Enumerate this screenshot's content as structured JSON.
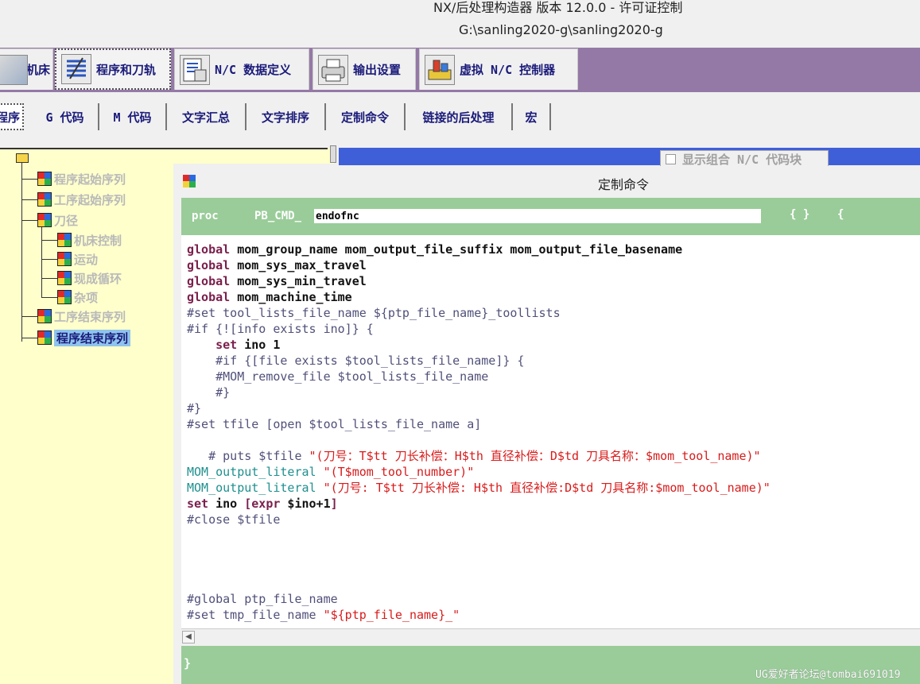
{
  "window": {
    "title": "NX/后处理构造器 版本 12.0.0 - 许可证控制",
    "path": "G:\\sanling2020-g\\sanling2020-g"
  },
  "main_tabs": [
    {
      "label": "机床",
      "icon": "machine-tool-icon"
    },
    {
      "label": "程序和刀轨",
      "icon": "program-toolpath-icon",
      "active": true
    },
    {
      "label": "N/C 数据定义",
      "icon": "nc-data-icon"
    },
    {
      "label": "输出设置",
      "icon": "printer-icon"
    },
    {
      "label": "虚拟 N/C 控制器",
      "icon": "virtual-controller-icon"
    }
  ],
  "sub_tabs": [
    {
      "label": "程序",
      "active": true
    },
    {
      "label": "G 代码"
    },
    {
      "label": "M 代码"
    },
    {
      "label": "文字汇总"
    },
    {
      "label": "文字排序"
    },
    {
      "label": "定制命令"
    },
    {
      "label": "链接的后处理"
    },
    {
      "label": "宏"
    }
  ],
  "tree": {
    "items": [
      {
        "label": "程序起始序列"
      },
      {
        "label": "工序起始序列"
      },
      {
        "label": "刀径"
      },
      {
        "label": "机床控制"
      },
      {
        "label": "运动"
      },
      {
        "label": "现成循环"
      },
      {
        "label": "杂项"
      },
      {
        "label": "工序结束序列"
      },
      {
        "label": "程序结束序列",
        "selected": true
      }
    ]
  },
  "checkbox": {
    "label": "显示组合 N/C 代码块",
    "checked": false
  },
  "dialog": {
    "title": "定制命令",
    "proc_label": "proc",
    "prefix_label": "PB_CMD_",
    "command_name": "endofnc",
    "braces_label": "{ }",
    "open_brace": "{",
    "close_brace": "}"
  },
  "code_lines": [
    [
      {
        "c": "kw",
        "t": "global"
      },
      {
        "c": "tx",
        "t": " mom_group_name mom_output_file_suffix mom_output_file_basename"
      }
    ],
    [
      {
        "c": "kw",
        "t": "global"
      },
      {
        "c": "tx",
        "t": " mom_sys_max_travel"
      }
    ],
    [
      {
        "c": "kw",
        "t": "global"
      },
      {
        "c": "tx",
        "t": " mom_sys_min_travel"
      }
    ],
    [
      {
        "c": "kw",
        "t": "global"
      },
      {
        "c": "tx",
        "t": " mom_machine_time"
      }
    ],
    [
      {
        "c": "cm",
        "t": "#set tool_lists_file_name ${ptp_file_name}_toollists"
      }
    ],
    [
      {
        "c": "cm",
        "t": "#if {![info exists ino]} {"
      }
    ],
    [
      {
        "c": "tx",
        "t": "    "
      },
      {
        "c": "kw",
        "t": "set"
      },
      {
        "c": "tx",
        "t": " ino 1"
      }
    ],
    [
      {
        "c": "cm",
        "t": "    #if {[file exists $tool_lists_file_name]} {"
      }
    ],
    [
      {
        "c": "cm",
        "t": "    #MOM_remove_file $tool_lists_file_name"
      }
    ],
    [
      {
        "c": "cm",
        "t": "    #}"
      }
    ],
    [
      {
        "c": "cm",
        "t": "#}"
      }
    ],
    [
      {
        "c": "cm",
        "t": "#set tfile [open $tool_lists_file_name a]"
      }
    ],
    [
      {
        "c": "tx",
        "t": ""
      }
    ],
    [
      {
        "c": "cm",
        "t": "   # puts $tfile "
      },
      {
        "c": "st",
        "t": "\"(刀号：T$tt 刀长补偿：H$th 直径补偿：D$td 刀具名称：$mom_tool_name)\""
      }
    ],
    [
      {
        "c": "tl",
        "t": "MOM_output_literal"
      },
      {
        "c": "st",
        "t": " \"(T$mom_tool_number)\""
      }
    ],
    [
      {
        "c": "tl",
        "t": "MOM_output_literal"
      },
      {
        "c": "st",
        "t": " \"(刀号: T$tt 刀长补偿: H$th 直径补偿:D$td 刀具名称:$mom_tool_name)\""
      }
    ],
    [
      {
        "c": "kw",
        "t": "set"
      },
      {
        "c": "tx",
        "t": " ino "
      },
      {
        "c": "kw",
        "t": "[expr"
      },
      {
        "c": "tx",
        "t": " $ino+1"
      },
      {
        "c": "kw",
        "t": "]"
      }
    ],
    [
      {
        "c": "cm",
        "t": "#close $tfile"
      }
    ],
    [
      {
        "c": "tx",
        "t": ""
      }
    ],
    [
      {
        "c": "tx",
        "t": ""
      }
    ],
    [
      {
        "c": "tx",
        "t": ""
      }
    ],
    [
      {
        "c": "tx",
        "t": ""
      }
    ],
    [
      {
        "c": "cm",
        "t": "#global ptp_file_name"
      }
    ],
    [
      {
        "c": "cm",
        "t": "#set tmp_file_name "
      },
      {
        "c": "st",
        "t": "\"${ptp_file_name}_\""
      }
    ]
  ],
  "watermark": "UG爱好者论坛@tombai691019",
  "colors": {
    "tab_bar": "#9479a6",
    "tree_bg": "#ffffcc",
    "blue_strip": "#3f5fd9",
    "green_bar": "#99cc99",
    "keyword": "#7a1f4c",
    "comment": "#50507a",
    "string": "#d81b1b",
    "literal_proc": "#1f8f8f"
  }
}
